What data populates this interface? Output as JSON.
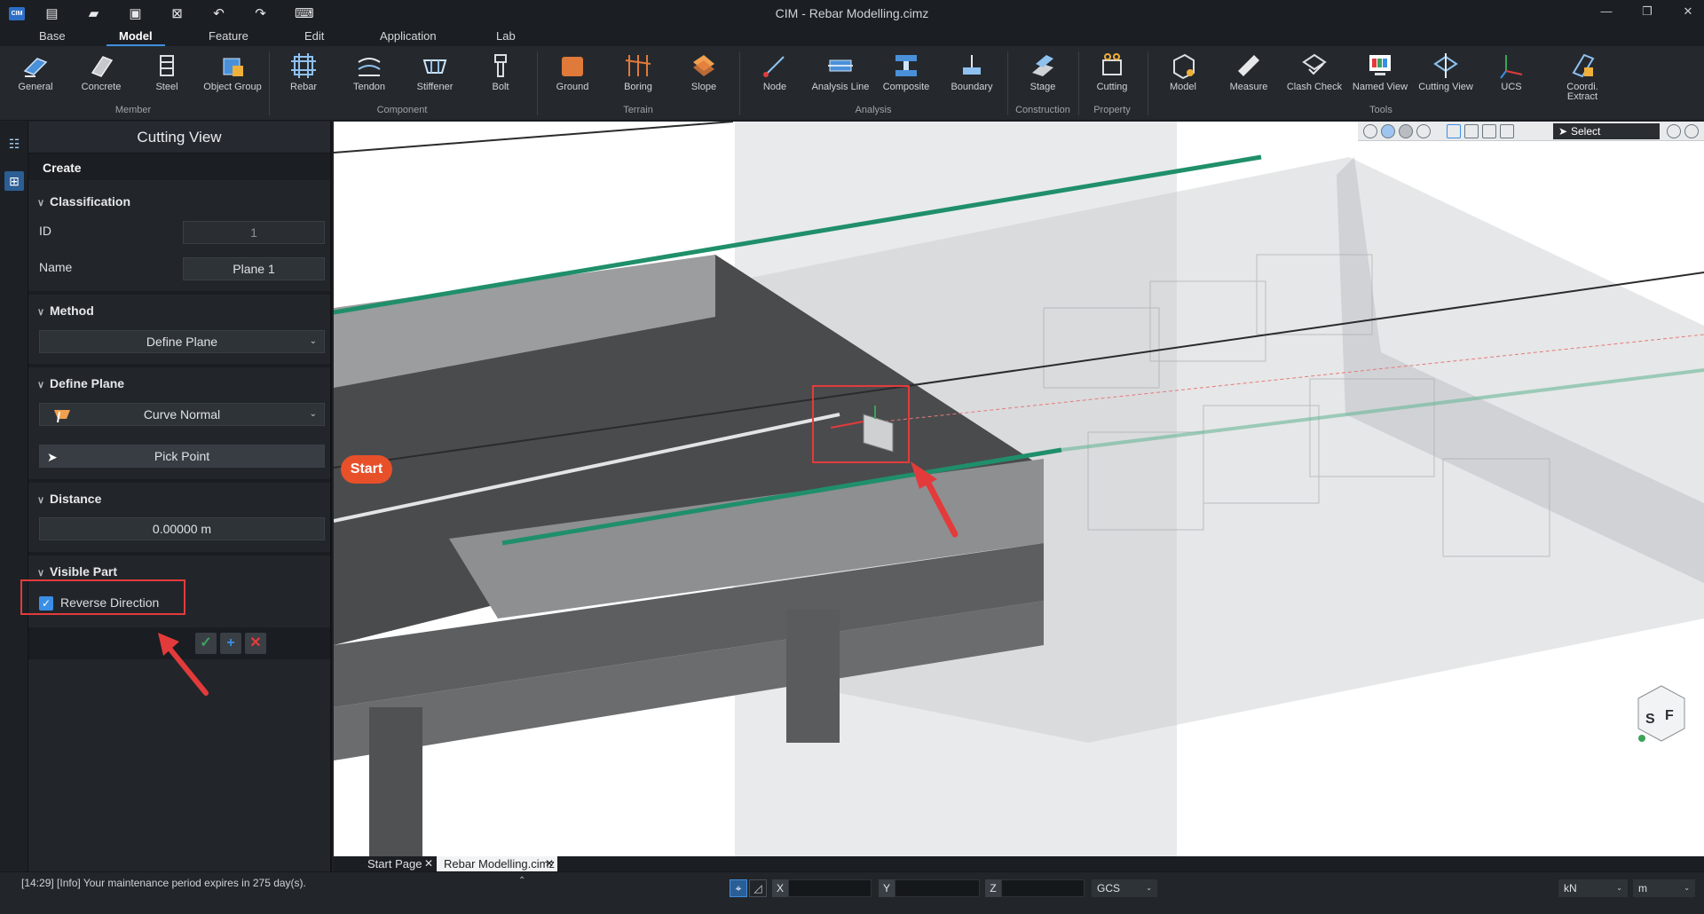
{
  "window": {
    "title": "CIM - Rebar Modelling.cimz",
    "logo": "CIM"
  },
  "quick_access": [
    "new-file-icon",
    "open-folder-icon",
    "save-icon",
    "close-file-icon",
    "undo-icon",
    "redo-icon",
    "keyboard-icon"
  ],
  "menu": {
    "tabs": [
      "Base",
      "Model",
      "Feature",
      "Edit",
      "Application",
      "Lab"
    ],
    "active": "Model"
  },
  "ribbon": {
    "items": {
      "general": "General",
      "concrete": "Concrete",
      "steel": "Steel",
      "object_group": "Object Group",
      "rebar": "Rebar",
      "tendon": "Tendon",
      "stiffener": "Stiffener",
      "bolt": "Bolt",
      "ground": "Ground",
      "boring": "Boring",
      "slope": "Slope",
      "node": "Node",
      "analysis_line": "Analysis Line",
      "composite": "Composite",
      "boundary": "Boundary",
      "stage": "Stage",
      "cutting": "Cutting",
      "model": "Model",
      "measure": "Measure",
      "clash_check": "Clash Check",
      "named_view": "Named View",
      "cutting_view": "Cutting View",
      "ucs": "UCS",
      "coordi_extract": "Coordi. Extract"
    },
    "groups": {
      "member": "Member",
      "component": "Component",
      "terrain": "Terrain",
      "analysis": "Analysis",
      "construction": "Construction",
      "property": "Property",
      "tools": "Tools"
    }
  },
  "panel": {
    "title": "Cutting View",
    "tab": "Create",
    "classification": {
      "header": "Classification",
      "id_label": "ID",
      "id_value": "1",
      "name_label": "Name",
      "name_value": "Plane 1"
    },
    "method": {
      "header": "Method",
      "value": "Define Plane"
    },
    "define_plane": {
      "header": "Define Plane",
      "curve_option": "Curve Normal",
      "pick_point": "Pick Point"
    },
    "distance": {
      "header": "Distance",
      "value": "0.00000 m"
    },
    "visible_part": {
      "header": "Visible Part",
      "reverse_label": "Reverse Direction",
      "reverse_checked": true
    }
  },
  "viewport": {
    "select_label": "Select",
    "start_badge": "Start",
    "view_cube_label_s": "S",
    "view_cube_label_f": "F"
  },
  "doc_tabs": [
    {
      "label": "Start Page",
      "active": false
    },
    {
      "label": "Rebar Modelling.cimz",
      "active": true
    }
  ],
  "status": {
    "message": "[14:29] [Info] Your maintenance period expires in 275 day(s).",
    "x_label": "X",
    "y_label": "Y",
    "z_label": "Z",
    "coord_system": "GCS",
    "force_unit": "kN",
    "length_unit": "m"
  },
  "colors": {
    "accent": "#3e8fe0",
    "start_badge": "#e8502a",
    "callout": "#e33b3b",
    "railing": "#1f8f6a"
  }
}
